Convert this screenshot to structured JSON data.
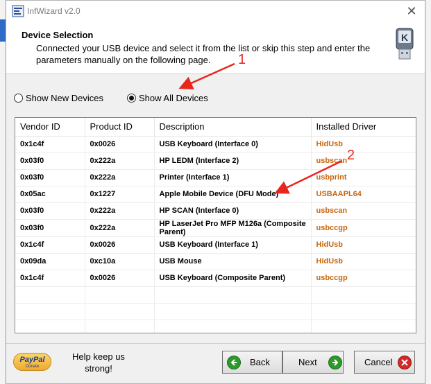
{
  "window": {
    "title": "InfWizard v2.0",
    "close_glyph": "✕"
  },
  "header": {
    "title": "Device Selection",
    "description": "Connected your USB device and select it from the list or skip this step and enter the parameters manually on the following page."
  },
  "options": {
    "show_new_label": "Show New Devices",
    "show_all_label": "Show All Devices",
    "selected": "show_all"
  },
  "table": {
    "columns": [
      "Vendor ID",
      "Product ID",
      "Description",
      "Installed Driver"
    ],
    "rows": [
      [
        "0x1c4f",
        "0x0026",
        "USB Keyboard (Interface 0)",
        "HidUsb"
      ],
      [
        "0x03f0",
        "0x222a",
        "HP LEDM (Interface 2)",
        "usbscan"
      ],
      [
        "0x03f0",
        "0x222a",
        "Printer (Interface 1)",
        "usbprint"
      ],
      [
        "0x05ac",
        "0x1227",
        "Apple Mobile Device (DFU Mode)",
        "USBAAPL64"
      ],
      [
        "0x03f0",
        "0x222a",
        "HP SCAN (Interface 0)",
        "usbscan"
      ],
      [
        "0x03f0",
        "0x222a",
        "HP LaserJet Pro MFP M126a (Composite Parent)",
        "usbccgp"
      ],
      [
        "0x1c4f",
        "0x0026",
        "USB Keyboard (Interface 1)",
        "HidUsb"
      ],
      [
        "0x09da",
        "0xc10a",
        "USB Mouse",
        "HidUsb"
      ],
      [
        "0x1c4f",
        "0x0026",
        "USB Keyboard (Composite Parent)",
        "usbccgp"
      ]
    ]
  },
  "footer": {
    "paypal_label": "PayPal",
    "paypal_sub": "Donate",
    "help_text": "Help keep us strong!",
    "back_label": "Back",
    "next_label": "Next",
    "cancel_label": "Cancel"
  },
  "annotations": {
    "marker_1": "1",
    "marker_2": "2",
    "color": "#e8261c"
  },
  "colors": {
    "driver_text": "#c7660f",
    "green_icon": "#2b9a2b",
    "red_icon": "#d22a2a"
  }
}
